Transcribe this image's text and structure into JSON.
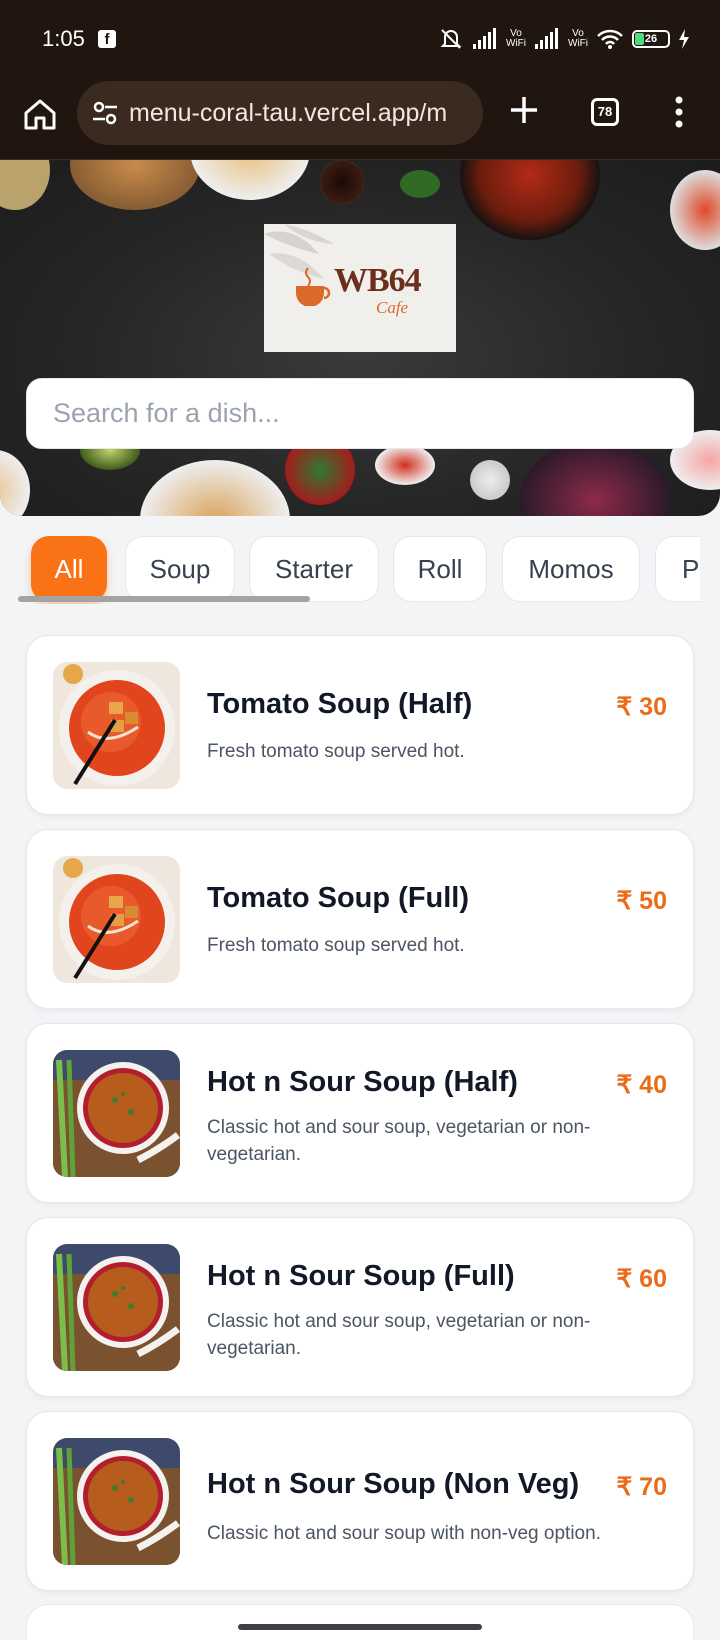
{
  "status_bar": {
    "time": "1:05",
    "app_icon": "facebook-icon",
    "network_labels": [
      "Vo",
      "WiFi",
      "Vo",
      "WiFi"
    ],
    "battery_level": "26",
    "icons": [
      "mute-icon",
      "signal-icon",
      "signal-icon",
      "wifi-icon",
      "battery-icon",
      "charging-icon"
    ]
  },
  "browser": {
    "url": "menu-coral-tau.vercel.app/m",
    "tab_count": "78",
    "icons": [
      "home-icon",
      "tune-icon",
      "plus-icon",
      "tabs-icon",
      "more-vert-icon"
    ]
  },
  "hero": {
    "logo_text": "WB64",
    "logo_subtext": "Cafe",
    "search_placeholder": "Search for a dish..."
  },
  "categories": {
    "items": [
      "All",
      "Soup",
      "Starter",
      "Roll",
      "Momos",
      "Pa"
    ],
    "active": "All",
    "active_color": "#f97316"
  },
  "menu": {
    "currency": "₹",
    "price_color": "#ea6c1a",
    "items": [
      {
        "name": "Tomato Soup (Half)",
        "price": "₹ 30",
        "description": "Fresh tomato soup served hot.",
        "image": "tomato-soup"
      },
      {
        "name": "Tomato Soup (Full)",
        "price": "₹ 50",
        "description": "Fresh tomato soup served hot.",
        "image": "tomato-soup"
      },
      {
        "name": "Hot n Sour Soup (Half)",
        "price": "₹ 40",
        "description": "Classic hot and sour soup, vegetarian or non-vegetarian.",
        "image": "hot-sour-soup"
      },
      {
        "name": "Hot n Sour Soup (Full)",
        "price": "₹ 60",
        "description": "Classic hot and sour soup, vegetarian or non-vegetarian.",
        "image": "hot-sour-soup"
      },
      {
        "name": "Hot n Sour Soup (Non Veg)",
        "price": "₹ 70",
        "description": "Classic hot and sour soup with non-veg option.",
        "image": "hot-sour-soup"
      }
    ]
  }
}
